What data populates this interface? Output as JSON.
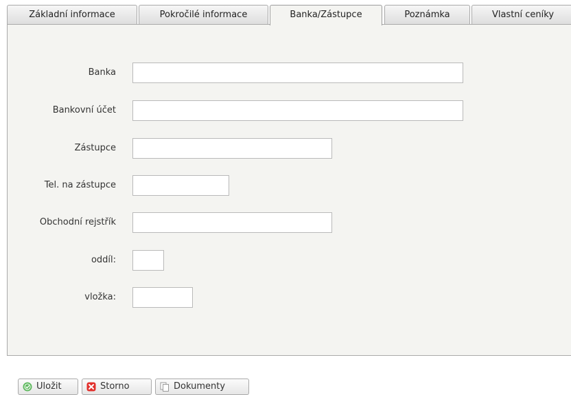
{
  "tabs": [
    {
      "label": "Základní informace"
    },
    {
      "label": "Pokročilé informace"
    },
    {
      "label": "Banka/Zástupce"
    },
    {
      "label": "Poznámka"
    },
    {
      "label": "Vlastní ceníky"
    }
  ],
  "active_tab": "Banka/Zástupce",
  "form": {
    "bank_label": "Banka",
    "bank_value": "",
    "account_label": "Bankovní účet",
    "account_value": "",
    "representative_label": "Zástupce",
    "representative_value": "",
    "rep_phone_label": "Tel. na zástupce",
    "rep_phone_value": "",
    "register_label": "Obchodní rejstřík",
    "register_value": "",
    "section_label": "oddíl:",
    "section_value": "",
    "insert_label": "vložka:",
    "insert_value": ""
  },
  "buttons": {
    "save": "Uložit",
    "cancel": "Storno",
    "documents": "Dokumenty"
  },
  "icons": {
    "save": "check-circle-icon",
    "cancel": "close-icon",
    "documents": "documents-icon"
  },
  "colors": {
    "panel_bg": "#f4f4f1",
    "save_icon": "#5cb85c",
    "cancel_icon": "#e2312d"
  }
}
